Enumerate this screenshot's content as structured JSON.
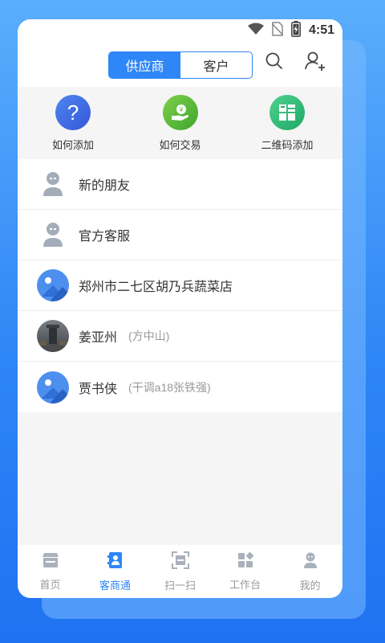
{
  "status_bar": {
    "time": "4:51"
  },
  "header": {
    "segments": [
      {
        "label": "供应商",
        "active": true
      },
      {
        "label": "客户",
        "active": false
      }
    ]
  },
  "quick_actions": [
    {
      "label": "如何添加",
      "icon": "question-icon",
      "color": "#3f6ee8"
    },
    {
      "label": "如何交易",
      "icon": "money-hand-icon",
      "color": "#5bb83a"
    },
    {
      "label": "二维码添加",
      "icon": "qrcode-icon",
      "color": "#34b87a"
    }
  ],
  "contacts": [
    {
      "name": "新的朋友",
      "sub": "",
      "avatar": "person-icon"
    },
    {
      "name": "官方客服",
      "sub": "",
      "avatar": "person-icon"
    },
    {
      "name": "郑州市二七区胡乃兵蔬菜店",
      "sub": "",
      "avatar": "image-placeholder-icon"
    },
    {
      "name": "姜亚州",
      "sub": "(方中山)",
      "avatar": "photo-avatar"
    },
    {
      "name": "贾书侠",
      "sub": "(干调a18张铁强)",
      "avatar": "image-placeholder-icon"
    }
  ],
  "tabbar": [
    {
      "label": "首页",
      "icon": "store-icon",
      "active": false
    },
    {
      "label": "客商通",
      "icon": "contacts-book-icon",
      "active": true
    },
    {
      "label": "扫一扫",
      "icon": "scan-icon",
      "active": false
    },
    {
      "label": "工作台",
      "icon": "grid-icon",
      "active": false
    },
    {
      "label": "我的",
      "icon": "user-icon",
      "active": false
    }
  ],
  "colors": {
    "accent": "#2f86f6",
    "text": "#333333",
    "muted": "#999999"
  }
}
